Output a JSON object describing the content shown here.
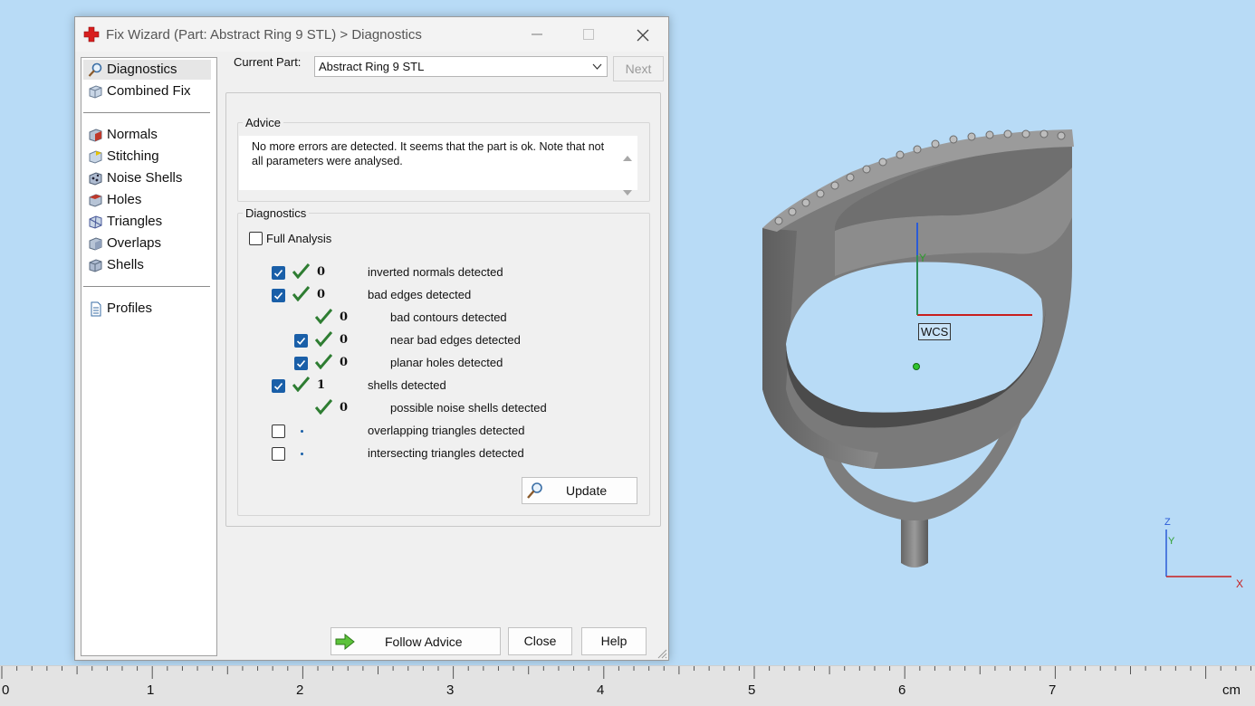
{
  "dialog": {
    "title": "Fix Wizard (Part: Abstract Ring 9 STL) > Diagnostics"
  },
  "sidebar": {
    "items": [
      {
        "label": "Diagnostics",
        "icon": "magnifier-icon",
        "selected": true
      },
      {
        "label": "Combined Fix",
        "icon": "cube-icon"
      },
      {
        "label": "Normals",
        "icon": "normals-cube-icon"
      },
      {
        "label": "Stitching",
        "icon": "stitching-cube-icon"
      },
      {
        "label": "Noise Shells",
        "icon": "noise-shells-icon"
      },
      {
        "label": "Holes",
        "icon": "holes-cube-icon"
      },
      {
        "label": "Triangles",
        "icon": "triangles-cube-icon"
      },
      {
        "label": "Overlaps",
        "icon": "overlaps-cube-icon"
      },
      {
        "label": "Shells",
        "icon": "shells-cube-icon"
      },
      {
        "label": "Profiles",
        "icon": "document-icon"
      }
    ]
  },
  "current_part": {
    "label": "Current Part:",
    "value": "Abstract Ring 9 STL",
    "next_label": "Next"
  },
  "advice": {
    "legend": "Advice",
    "text": "No more errors are detected. It seems that the part is ok. Note that not all parameters were analysed."
  },
  "diagnostics": {
    "legend": "Diagnostics",
    "full_analysis_label": "Full Analysis",
    "full_analysis_checked": false,
    "rows": [
      {
        "checkbox": "checked",
        "status": "ok",
        "count": "0",
        "label": "inverted normals detected"
      },
      {
        "checkbox": "checked",
        "status": "ok",
        "count": "0",
        "label": "bad edges detected"
      },
      {
        "checkbox": "none",
        "status": "ok",
        "count": "0",
        "label": "bad contours detected"
      },
      {
        "checkbox": "checked",
        "status": "ok",
        "count": "0",
        "label": "near bad edges detected"
      },
      {
        "checkbox": "checked",
        "status": "ok",
        "count": "0",
        "label": "planar holes detected"
      },
      {
        "checkbox": "checked",
        "status": "ok",
        "count": "1",
        "label": "shells detected"
      },
      {
        "checkbox": "none",
        "status": "ok",
        "count": "0",
        "label": "possible noise shells detected"
      },
      {
        "checkbox": "unchecked",
        "status": "pending",
        "count": "",
        "label": "overlapping triangles detected"
      },
      {
        "checkbox": "unchecked",
        "status": "pending",
        "count": "",
        "label": "intersecting triangles detected"
      }
    ],
    "update_label": "Update"
  },
  "footer": {
    "follow_advice_label": "Follow Advice",
    "close_label": "Close",
    "help_label": "Help"
  },
  "viewport": {
    "wcs_label": "WCS",
    "axis_x": "X",
    "axis_y": "Y",
    "axis_z": "Z"
  },
  "ruler": {
    "marks": [
      "0",
      "1",
      "2",
      "3",
      "4",
      "5",
      "6",
      "7"
    ],
    "unit": "cm"
  },
  "colors": {
    "viewport_bg": "#b8dbf6",
    "check_blue": "#1a5fa8",
    "ok_green": "#2e7d32",
    "app_red": "#d81e1e"
  }
}
